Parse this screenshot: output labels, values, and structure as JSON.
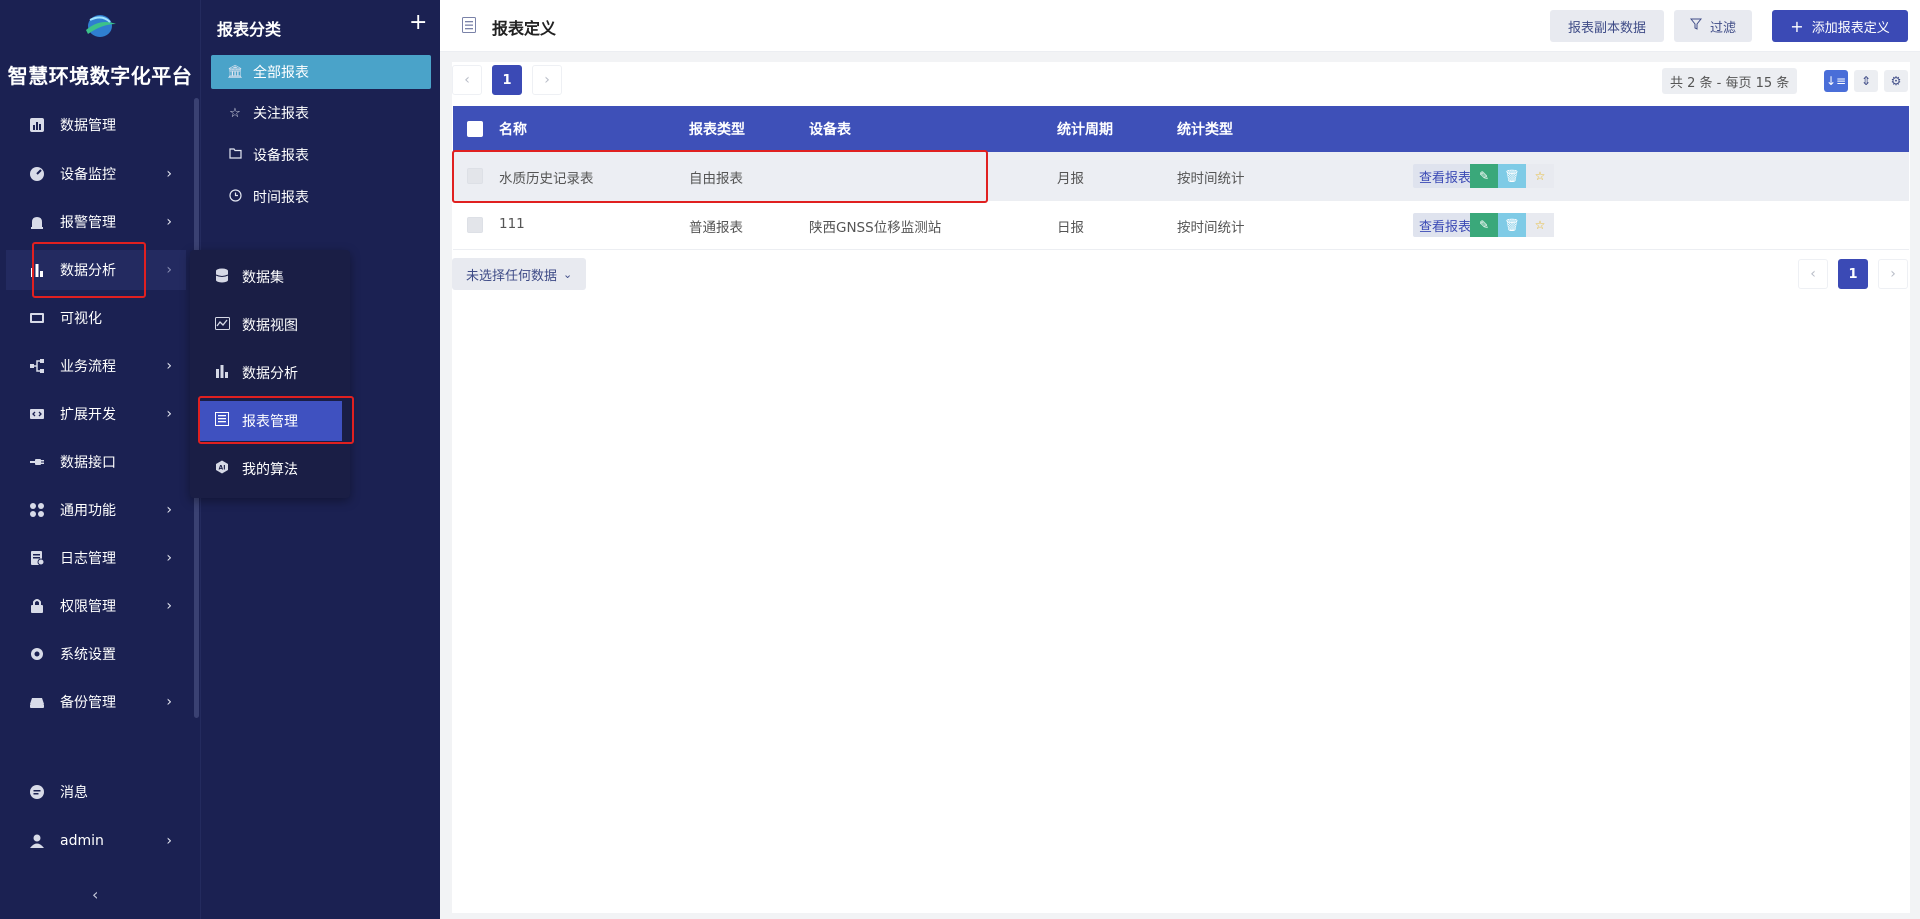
{
  "nav": {
    "brand": "智慧环境数字化平台",
    "items": [
      {
        "label": "数据管理",
        "icon": "bar-chart-icon",
        "arrow": false
      },
      {
        "label": "设备监控",
        "icon": "gauge-icon",
        "arrow": true
      },
      {
        "label": "报警管理",
        "icon": "alarm-icon",
        "arrow": true
      },
      {
        "label": "数据分析",
        "icon": "analytics-icon",
        "arrow": true
      },
      {
        "label": "可视化",
        "icon": "monitor-icon",
        "arrow": false
      },
      {
        "label": "业务流程",
        "icon": "flow-icon",
        "arrow": true
      },
      {
        "label": "扩展开发",
        "icon": "code-icon",
        "arrow": true
      },
      {
        "label": "数据接口",
        "icon": "plug-icon",
        "arrow": false
      },
      {
        "label": "通用功能",
        "icon": "grid-icon",
        "arrow": true
      },
      {
        "label": "日志管理",
        "icon": "log-icon",
        "arrow": true
      },
      {
        "label": "权限管理",
        "icon": "lock-icon",
        "arrow": true
      },
      {
        "label": "系统设置",
        "icon": "gear-icon",
        "arrow": false
      },
      {
        "label": "备份管理",
        "icon": "drive-icon",
        "arrow": true
      }
    ],
    "message": "消息",
    "user": "admin"
  },
  "category": {
    "title": "报表分类",
    "items": [
      {
        "label": "全部报表",
        "icon": "bank-icon"
      },
      {
        "label": "关注报表",
        "icon": "star-icon"
      },
      {
        "label": "设备报表",
        "icon": "folder-icon"
      },
      {
        "label": "时间报表",
        "icon": "clock-icon"
      }
    ]
  },
  "flyout": {
    "items": [
      {
        "label": "数据集",
        "icon": "database-icon"
      },
      {
        "label": "数据视图",
        "icon": "chart-view-icon"
      },
      {
        "label": "数据分析",
        "icon": "analytics-icon"
      },
      {
        "label": "报表管理",
        "icon": "report-icon"
      },
      {
        "label": "我的算法",
        "icon": "ai-icon"
      }
    ]
  },
  "header": {
    "title": "报表定义",
    "btn_copy": "报表副本数据",
    "btn_filter": "过滤",
    "btn_add": "添加报表定义"
  },
  "pager": {
    "current": "1",
    "count_text": "共 2 条 - 每页 15 条"
  },
  "table": {
    "columns": [
      "名称",
      "报表类型",
      "设备表",
      "统计周期",
      "统计类型"
    ],
    "rows": [
      {
        "name": "水质历史记录表",
        "type": "自由报表",
        "device": "",
        "period": "月报",
        "stat": "按时间统计"
      },
      {
        "name": "111",
        "type": "普通报表",
        "device": "陕西GNSS位移监测站",
        "period": "日报",
        "stat": "按时间统计"
      }
    ],
    "view_label": "查看报表"
  },
  "selection": {
    "label": "未选择任何数据"
  },
  "colors": {
    "nav_bg": "#1b2152",
    "primary": "#3b4ab5",
    "cat_active": "#4aa3c9",
    "highlight": "#e02020"
  }
}
